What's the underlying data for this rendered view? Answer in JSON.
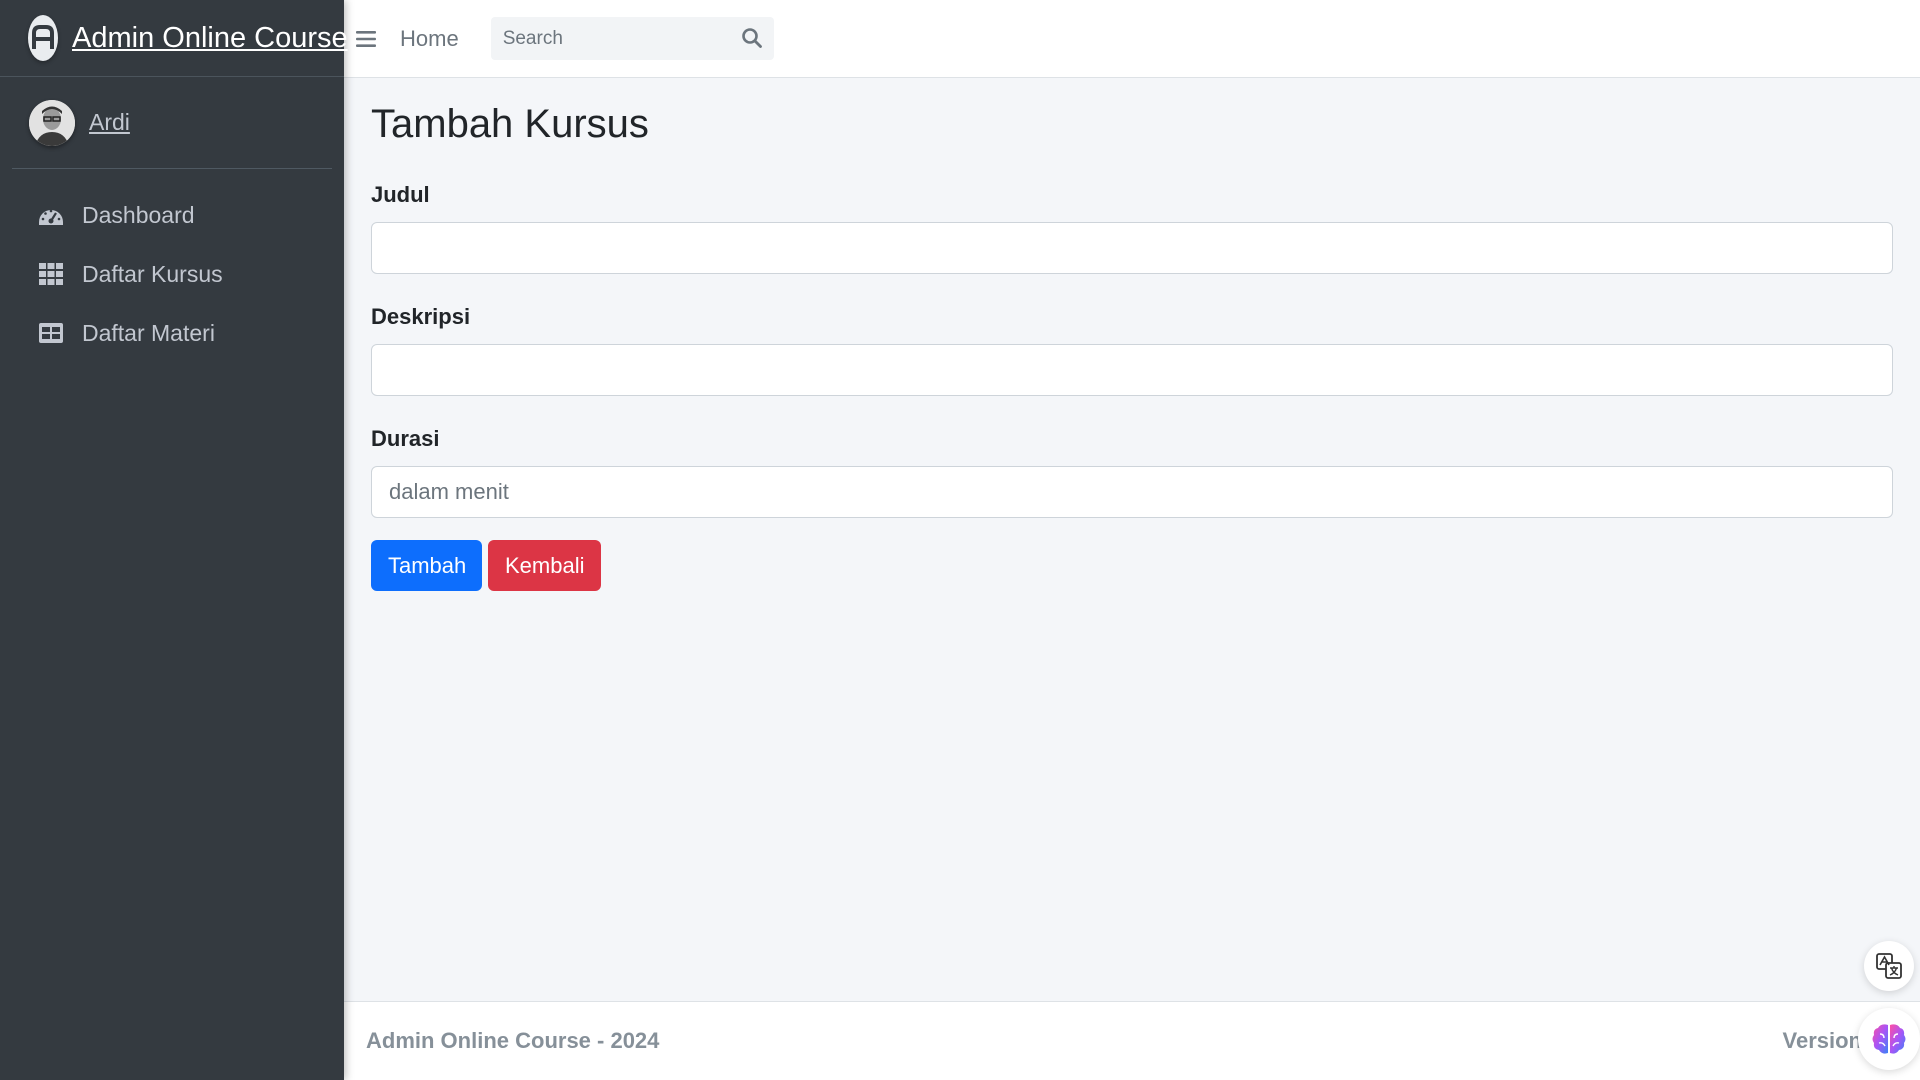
{
  "brand": {
    "title": "Admin Online Course"
  },
  "user": {
    "name": "Ardi"
  },
  "sidebar": {
    "items": [
      {
        "label": "Dashboard",
        "icon": "dashboard-icon"
      },
      {
        "label": "Daftar Kursus",
        "icon": "grid-icon"
      },
      {
        "label": "Daftar Materi",
        "icon": "table-icon"
      }
    ]
  },
  "topbar": {
    "home_label": "Home",
    "search_placeholder": "Search"
  },
  "page": {
    "title": "Tambah Kursus"
  },
  "form": {
    "judul_label": "Judul",
    "judul_value": "",
    "deskripsi_label": "Deskripsi",
    "deskripsi_value": "",
    "durasi_label": "Durasi",
    "durasi_placeholder": "dalam menit",
    "submit_label": "Tambah",
    "back_label": "Kembali"
  },
  "footer": {
    "text": "Admin Online Course - 2024",
    "version_label": "Version"
  },
  "colors": {
    "sidebar_bg": "#343a40",
    "primary": "#0d6efd",
    "danger": "#dc3545",
    "content_bg": "#f4f6f9"
  }
}
